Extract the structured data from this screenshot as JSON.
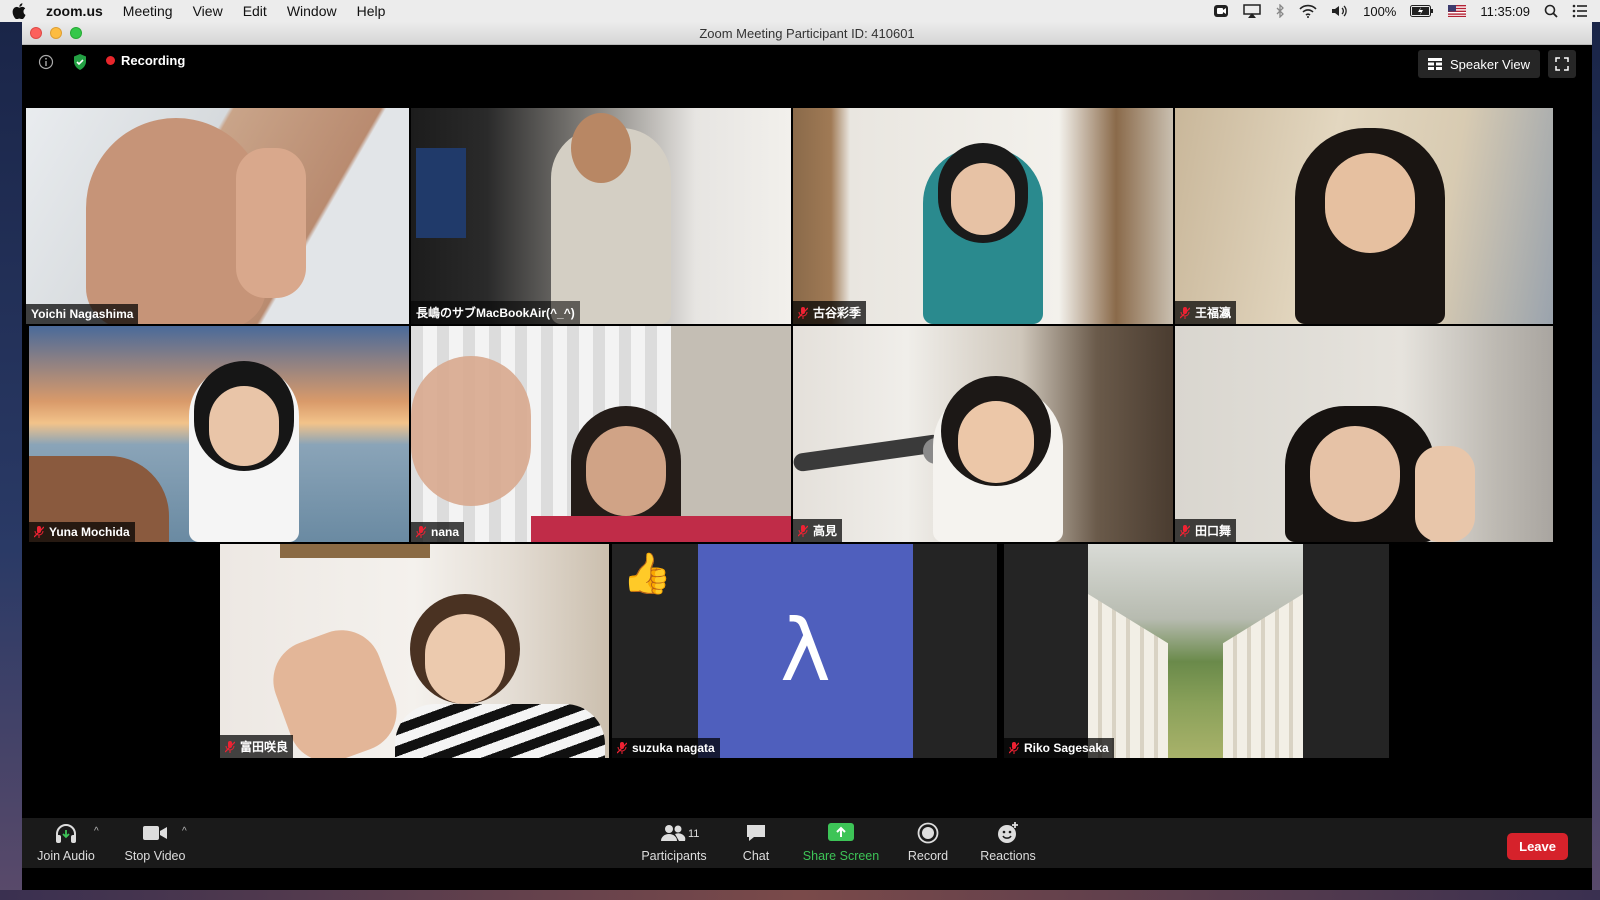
{
  "menubar": {
    "app": "zoom.us",
    "menus": [
      "Meeting",
      "View",
      "Edit",
      "Window",
      "Help"
    ],
    "battery": "100%",
    "time": "11:35:09"
  },
  "window": {
    "title": "Zoom Meeting Participant ID: 410601"
  },
  "topbar": {
    "recording_label": "Recording",
    "speaker_view_label": "Speaker View"
  },
  "participants": [
    {
      "name": "Yoichi Nagashima",
      "muted": false,
      "active_speaker": true
    },
    {
      "name": "長嶋のサブMacBookAir(^_^)",
      "muted": false
    },
    {
      "name": "古谷彩季",
      "muted": true
    },
    {
      "name": "王福瀛",
      "muted": true
    },
    {
      "name": "Yuna Mochida",
      "muted": true
    },
    {
      "name": "nana",
      "muted": true
    },
    {
      "name": "高見",
      "muted": true
    },
    {
      "name": "田口舞",
      "muted": true
    },
    {
      "name": "富田咲良",
      "muted": true
    },
    {
      "name": "suzuka nagata",
      "muted": true,
      "avatar_text": "λ",
      "reaction": "👍"
    },
    {
      "name": "Riko Sagesaka",
      "muted": true
    }
  ],
  "toolbar": {
    "join_audio": "Join Audio",
    "stop_video": "Stop Video",
    "participants": "Participants",
    "participant_count": "11",
    "chat": "Chat",
    "share_screen": "Share Screen",
    "record": "Record",
    "reactions": "Reactions",
    "leave": "Leave"
  },
  "colors": {
    "active_border": "#b7e34a",
    "share_green": "#3dc457",
    "leave_red": "#d6222b",
    "avatar_blue": "#4f5fbd"
  }
}
